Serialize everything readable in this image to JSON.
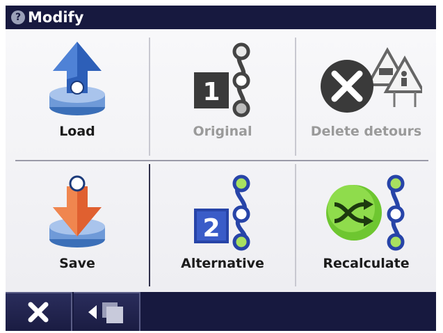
{
  "window": {
    "title": "Modify",
    "help_icon_glyph": "?"
  },
  "tiles": [
    {
      "id": "load",
      "label": "Load",
      "enabled": true,
      "icon": "upload-arrow-icon"
    },
    {
      "id": "original",
      "label": "Original",
      "enabled": false,
      "icon": "route-number-1-icon",
      "badge": "1"
    },
    {
      "id": "delete-detours",
      "label": "Delete detours",
      "enabled": false,
      "icon": "delete-detours-icon"
    },
    {
      "id": "save",
      "label": "Save",
      "enabled": true,
      "icon": "download-arrow-icon"
    },
    {
      "id": "alternative",
      "label": "Alternative",
      "enabled": true,
      "icon": "route-number-2-icon",
      "badge": "2"
    },
    {
      "id": "recalculate",
      "label": "Recalculate",
      "enabled": true,
      "icon": "shuffle-route-icon"
    }
  ],
  "bottom_bar": {
    "close_icon": "close-icon",
    "back_icon": "back-windows-icon"
  },
  "colors": {
    "bar": "#17193f",
    "blue_arrow": "#2d5fb8",
    "orange_arrow": "#e06030",
    "green": "#7fd03a",
    "disabled_gray": "#9a9a9a"
  }
}
